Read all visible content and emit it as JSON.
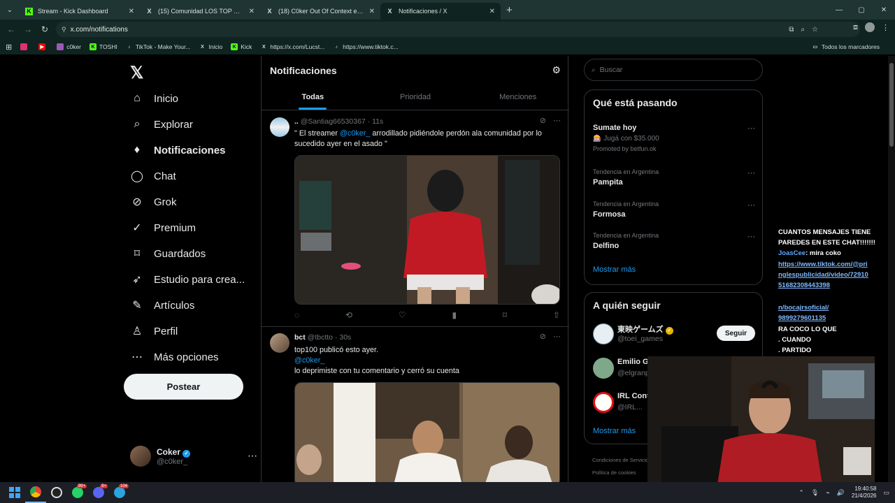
{
  "browser": {
    "tabs": [
      {
        "title": "Stream - Kick Dashboard",
        "icon": "K",
        "color": "#53fc18"
      },
      {
        "title": "(15) Comunidad LOS TOP GLOB",
        "icon": "X",
        "color": "#ffffff"
      },
      {
        "title": "(18) C0ker Out Of Context en X",
        "icon": "X",
        "color": "#ffffff"
      },
      {
        "title": "Notificaciones / X",
        "icon": "X",
        "color": "#ffffff"
      }
    ],
    "url": "x.com/notifications",
    "bookmarks": [
      {
        "label": "",
        "icon": "instagram-icon",
        "color": "#e1306c"
      },
      {
        "label": "",
        "icon": "youtube-icon",
        "color": "#ff0000"
      },
      {
        "label": "c0ker",
        "icon": "kick-icon",
        "color": "#9b59b6"
      },
      {
        "label": "TOSHI",
        "icon": "kick-icon",
        "color": "#53fc18"
      },
      {
        "label": "TikTok - Make Your...",
        "icon": "tiktok-icon",
        "color": "#ffffff"
      },
      {
        "label": "Inicio",
        "icon": "x-icon",
        "color": "#ffffff"
      },
      {
        "label": "Kick",
        "icon": "kick-icon",
        "color": "#53fc18"
      },
      {
        "label": "https://x.com/Lucst...",
        "icon": "x-icon",
        "color": "#ffffff"
      },
      {
        "label": "https://www.tiktok.c...",
        "icon": "tiktok-icon",
        "color": "#ffffff"
      }
    ],
    "all_bookmarks": "Todos los marcadores"
  },
  "nav": {
    "items": [
      {
        "label": "Inicio",
        "icon": "home-icon",
        "glyph": "⌂"
      },
      {
        "label": "Explorar",
        "icon": "search-icon",
        "glyph": "⌕"
      },
      {
        "label": "Notificaciones",
        "icon": "bell-icon",
        "glyph": "🔔"
      },
      {
        "label": "Chat",
        "icon": "chat-icon",
        "glyph": "◯"
      },
      {
        "label": "Grok",
        "icon": "grok-icon",
        "glyph": "⊘"
      },
      {
        "label": "Premium",
        "icon": "premium-icon",
        "glyph": "✓"
      },
      {
        "label": "Guardados",
        "icon": "bookmark-icon",
        "glyph": "⌑"
      },
      {
        "label": "Estudio para crea...",
        "icon": "rocket-icon",
        "glyph": "➶"
      },
      {
        "label": "Artículos",
        "icon": "article-icon",
        "glyph": "✎"
      },
      {
        "label": "Perfil",
        "icon": "person-icon",
        "glyph": "♙"
      },
      {
        "label": "Más opciones",
        "icon": "more-icon",
        "glyph": "⋯"
      }
    ],
    "post_button": "Postear",
    "user": {
      "name": "Coker",
      "handle": "@c0ker_"
    }
  },
  "feed": {
    "title": "Notificaciones",
    "tabs": [
      "Todas",
      "Prioridad",
      "Menciones"
    ],
    "tweets": [
      {
        "name": "..",
        "handle": "@Santiag66530367",
        "time": "· 11s",
        "text_a": "\" El streamer ",
        "mention": "@c0ker_",
        "text_b": " arrodillado pidiéndole perdón ala comunidad por lo sucedido ayer en el asado \""
      },
      {
        "name": "bct",
        "handle": "@tbctto",
        "time": "· 30s",
        "line1": "top100 publicó esto ayer.",
        "mention": "@c0ker_",
        "line3": "lo deprimiste con tu comentario y cerró su cuenta"
      }
    ]
  },
  "right": {
    "search_placeholder": "Buscar",
    "trending_title": "Qué está pasando",
    "promo": {
      "title": "Sumate hoy",
      "sub": "🎰 Jugá con $35.000",
      "promoted": "Promoted by betfun.ok"
    },
    "trends": [
      {
        "category": "Tendencia en Argentina",
        "name": "Pampita"
      },
      {
        "category": "Tendencia en Argentina",
        "name": "Formosa"
      },
      {
        "category": "Tendencia en Argentina",
        "name": "Delfino"
      }
    ],
    "show_more": "Mostrar más",
    "follow_title": "A quién seguir",
    "follow": [
      {
        "name": "東映ゲームズ",
        "handle": "@toei_games",
        "button": "Seguir"
      },
      {
        "name": "Emilio G",
        "handle": "@elgranp"
      },
      {
        "name": "IRL Cont",
        "handle": "@IRL..."
      }
    ],
    "show_more_2": "Mostrar más",
    "footer_1": "Condiciones de Servicio",
    "footer_2": "Política de cookies"
  },
  "stream_chat": {
    "l1": "CUANTOS MENSAJES TIENE",
    "l2": "PAREDES EN ESTE CHAT!!!!!!!",
    "user": "JoasCee",
    "msg": ": mira coko",
    "link1": "https://www.tiktok.com/@pri",
    "link2": "nglespublicidad/video/72910",
    "link3": "51682308443398",
    "l6": "n/bocajrsoficial/",
    "l7": "9899279601135",
    "l8": "RA COCO LO QUE",
    "l9": ". CUANDO",
    "l10": ". PARTIDO"
  },
  "taskbar": {
    "time": "19:40:58",
    "date": "21/4/2026",
    "badges": [
      "99+",
      "9+",
      "104"
    ]
  }
}
